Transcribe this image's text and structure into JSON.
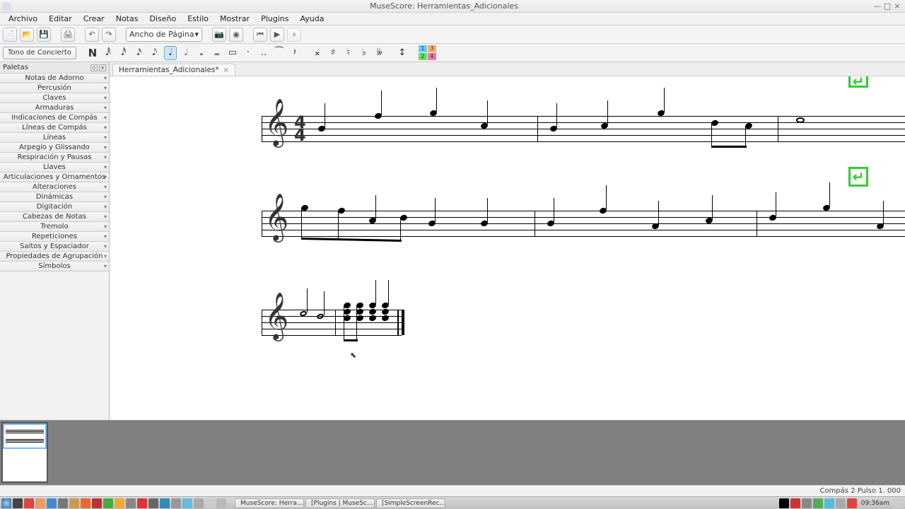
{
  "window": {
    "title": "MuseScore: Herramientas_Adicionales",
    "min": "—",
    "max": "□",
    "close": "×"
  },
  "menu": [
    "Archivo",
    "Editar",
    "Crear",
    "Notas",
    "Diseño",
    "Estilo",
    "Mostrar",
    "Plugins",
    "Ayuda"
  ],
  "toolbar": {
    "zoom_label": "Ancho de Página",
    "zoom_caret": "▾"
  },
  "toolbar2": {
    "concert_pitch": "Tono de Concierto",
    "note_input": "N",
    "voices": [
      "1",
      "2",
      "3",
      "4"
    ]
  },
  "palettes": {
    "title": "Paletas",
    "items": [
      "Notas de Adorno",
      "Percusión",
      "Claves",
      "Armaduras",
      "Indicaciones de Compás",
      "Líneas de Compás",
      "Líneas",
      "Arpegio y Glissando",
      "Respiración y Pausas",
      "Llaves",
      "Articulaciones y Ornamentos",
      "Alteraciones",
      "Dinámicas",
      "Digitación",
      "Cabezas de Notas",
      "Tremolo",
      "Repeticiones",
      "Saltos y Espaciador",
      "Propiedades de Agrupación",
      "Símbolos"
    ]
  },
  "tab": {
    "label": "Herramientas_Adicionales*",
    "close": "×"
  },
  "timesig": {
    "num": "4",
    "den": "4"
  },
  "sysbreak": "↵",
  "status": "Compás  2 Pulso  1. 000",
  "taskbar": {
    "tasks": [
      "MuseScore: Herra…",
      "[Plugins | MuseSc…",
      "[SimpleScreenRec…"
    ],
    "clock": "09:36am"
  },
  "clef": "𝄞"
}
